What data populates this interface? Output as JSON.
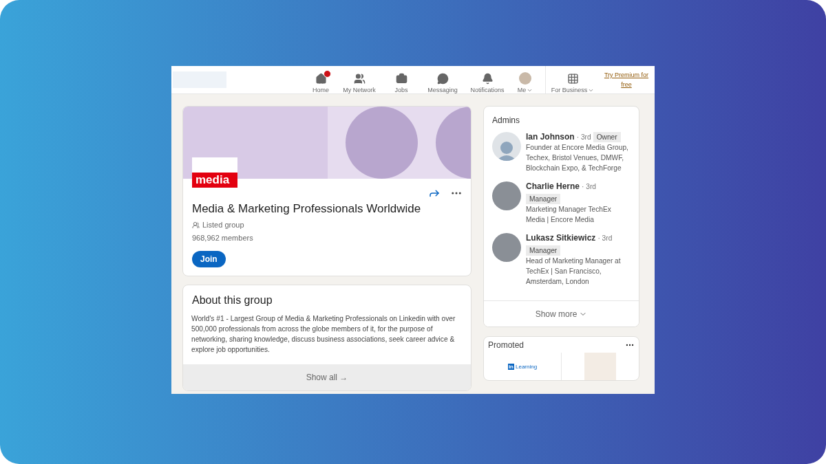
{
  "nav": {
    "items": [
      {
        "label": "Home",
        "badge": true,
        "caret": false
      },
      {
        "label": "My Network"
      },
      {
        "label": "Jobs"
      },
      {
        "label": "Messaging"
      },
      {
        "label": "Notifications"
      },
      {
        "label": "Me",
        "badge": false,
        "caret": true
      }
    ],
    "business": {
      "label": "For Business",
      "caret": true
    },
    "premium": "Try Premium for free"
  },
  "group": {
    "logo": "media",
    "name": "Media & Marketing Professionals Worldwide",
    "visibility": "Listed group",
    "members": "968,962 members",
    "join": "Join"
  },
  "about": {
    "title": "About this group",
    "text": "World's #1 - Largest Group of Media & Marketing Professionals on Linkedin with over 500,000 professionals from across the globe members of it, for the purpose of networking, sharing knowledge, discuss business associations, seek career advice & explore job opportunities.",
    "show_all": "Show all →"
  },
  "admins": {
    "title": "Admins",
    "people": [
      {
        "name": "Ian Johnson",
        "degree": "· 3rd",
        "role": "Owner",
        "headline": "Founder at Encore Media Group, Techex, Bristol Venues, DMWF, Blockchain Expo, & TechForge",
        "kind": "silhouette"
      },
      {
        "name": "Charlie Herne",
        "degree": "· 3rd",
        "role": "Manager",
        "headline": "Marketing Manager TechEx Media | Encore Media",
        "kind": "photo"
      },
      {
        "name": "Lukasz Sitkiewicz",
        "degree": "· 3rd",
        "role": "Manager",
        "headline": "Head of Marketing Manager at TechEx | San Francisco, Amsterdam, London",
        "kind": "photo"
      }
    ],
    "show_more": "Show more"
  },
  "promoted": {
    "title": "Promoted",
    "ad_logo": "in",
    "ad_brand": "Learning"
  }
}
